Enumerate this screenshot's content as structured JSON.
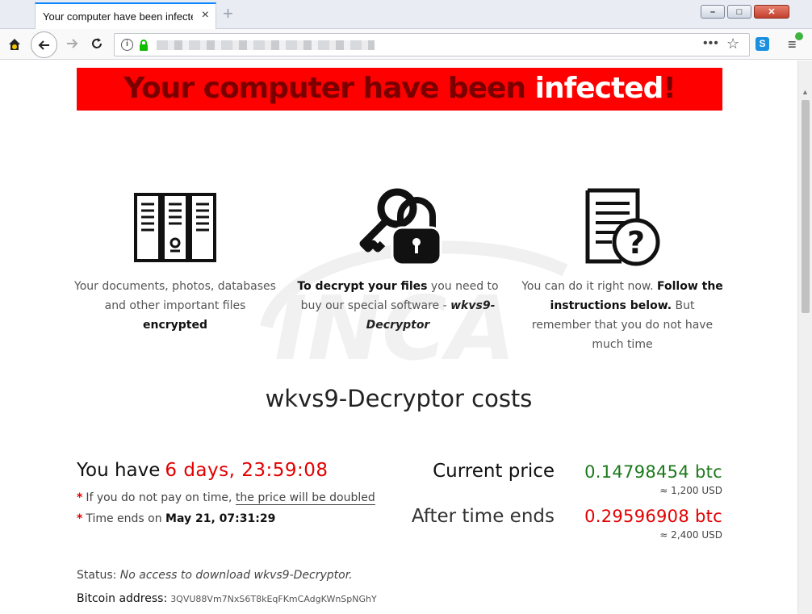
{
  "browser": {
    "tab_title": "Your computer have been infected",
    "tab_close": "×",
    "new_tab": "+",
    "win_min": "–",
    "win_max": "□",
    "win_close": "✕",
    "url": "",
    "page_actions": "•••",
    "bookmark_star": "☆",
    "ext_label": "S",
    "menu": "≡"
  },
  "banner": {
    "text_dark": "Your computer have been ",
    "text_highlight": "infected",
    "text_tail": "!"
  },
  "features": [
    {
      "icon": "file-cabinet-icon",
      "normal_1": "Your documents, photos, databases and other important files ",
      "bold_1": "encrypted"
    },
    {
      "icon": "key-padlock-icon",
      "bold_1": "To decrypt your files",
      "normal_1": " you need to buy our special software - ",
      "italic_1": "wkvs9-Decryptor"
    },
    {
      "icon": "document-question-icon",
      "normal_1": "You can do it right now. ",
      "bold_1": "Follow the instructions below.",
      "normal_2": " But remember that you do not have much time"
    }
  ],
  "costs_title": "wkvs9-Decryptor costs",
  "timer": {
    "label": "You have",
    "value": "6 days, 23:59:08"
  },
  "notes": [
    {
      "star": "*",
      "text": "If you do not pay on time, ",
      "underlined": "the price will be doubled"
    },
    {
      "star": "*",
      "text": "Time ends on ",
      "bold": "May 21, 07:31:29"
    }
  ],
  "prices": {
    "current_label": "Current price",
    "current_btc": "0.14798454 btc",
    "current_usd": "≈ 1,200 USD",
    "after_label": "After time ends",
    "after_btc": "0.29596908 btc",
    "after_usd": "≈ 2,400 USD"
  },
  "status": {
    "label": "Status: ",
    "value": "No access to download wkvs9-Decryptor."
  },
  "bitcoin": {
    "label": "Bitcoin address:",
    "value": "3QVU88Vm7NxS6T8kEqFKmCAdgKWnSpNGhY"
  },
  "watermark_text": "INCA",
  "colors": {
    "banner_red": "#fe0000",
    "timer_red": "#e30000",
    "price_green": "#1a7a1a",
    "price_red": "#e30000",
    "firefox_blue": "#0a84ff"
  }
}
